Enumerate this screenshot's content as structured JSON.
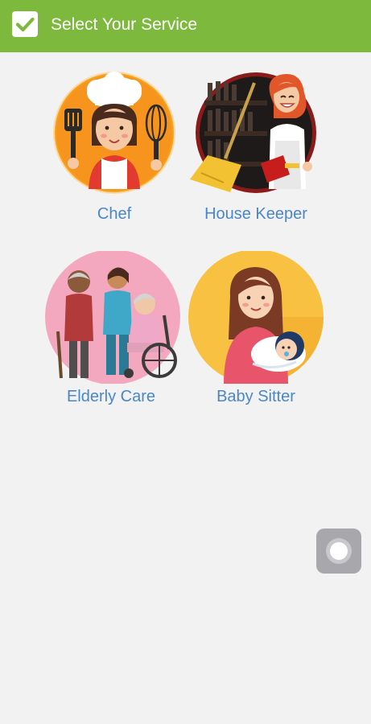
{
  "appbar": {
    "title": "Select Your Service",
    "icon": "check-icon",
    "color": "#7cb93c"
  },
  "services": [
    {
      "label": "Chef",
      "icon": "chef-illustration"
    },
    {
      "label": "House Keeper",
      "icon": "housekeeper-illustration"
    },
    {
      "label": "Elderly Care",
      "icon": "elderly-care-illustration"
    },
    {
      "label": "Baby Sitter",
      "icon": "baby-sitter-illustration"
    }
  ],
  "colors": {
    "label": "#4a86c8",
    "background": "#f2f2f2"
  },
  "assistive_button": {
    "icon": "assistive-touch-icon"
  }
}
